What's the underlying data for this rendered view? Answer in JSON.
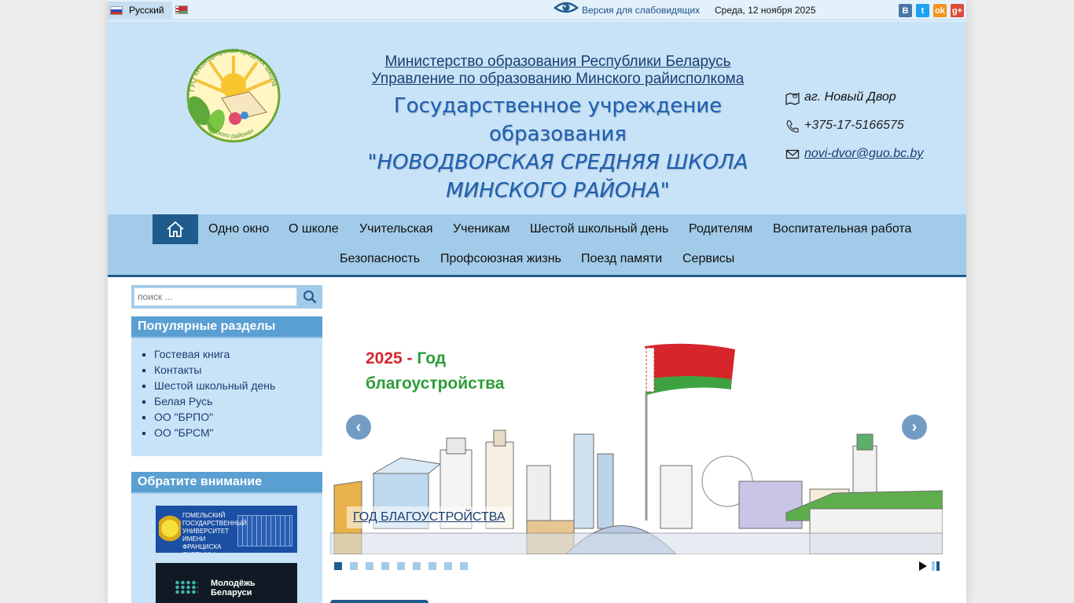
{
  "topbar": {
    "language_current": "Русский",
    "low_vision_label": "Версия для слабовидящих",
    "date": "Среда, 12 ноября 2025",
    "social": [
      "В",
      "t",
      "ok",
      "g+"
    ]
  },
  "header": {
    "logo_text_top": "ГУО «Новодворская средняя школа",
    "logo_text_bottom": "Минского района»",
    "ministry_line1": "Министерство образования Республики Беларусь",
    "ministry_line2": "Управление по образованию Минского райисполкома",
    "school_line1": "Государственное учреждение образования",
    "school_line2": "\"НОВОДВОРСКАЯ СРЕДНЯЯ ШКОЛА",
    "school_line3": "МИНСКОГО РАЙОНА\"",
    "address": "аг. Новый Двор",
    "phone": "+375-17-5166575",
    "email": "novi-dvor@guo.bc.by"
  },
  "nav": {
    "items": [
      "Одно окно",
      "О школе",
      "Учительская",
      "Ученикам",
      "Шестой школьный день",
      "Родителям",
      "Воспитательная работа",
      "Безопасность",
      "Профсоюзная жизнь",
      "Поезд памяти",
      "Сервисы"
    ]
  },
  "search": {
    "placeholder": "поиск ..."
  },
  "popular": {
    "title": "Популярные разделы",
    "items": [
      "Гостевая книга",
      "Контакты",
      "Шестой школьный день",
      "Белая Русь",
      "ОО \"БРПО\"",
      "ОО \"БРСМ\""
    ]
  },
  "attention": {
    "title": "Обратите внимание",
    "banner1_text": "ГОМЕЛЬСКИЙ ГОСУДАРСТВЕННЫЙ УНИВЕРСИТЕТ ИМЕНИ ФРАНЦИСКА СКОРЫНЫ",
    "banner2_text": "Молодёжь Беларуси"
  },
  "slider": {
    "year_line1_num": "2025 -",
    "year_line1_word": "Год",
    "year_line2": "благоустройства",
    "caption": "ГОД БЛАГОУСТРОЙСТВА",
    "prev_label": "‹",
    "next_label": "›",
    "slide_count": 9,
    "active_slide": 1
  },
  "colors": {
    "header_bg": "#c8e3f8",
    "nav_bg": "#a2cbe9",
    "accent": "#1f5b8d",
    "box_title": "#5a9fd2"
  }
}
